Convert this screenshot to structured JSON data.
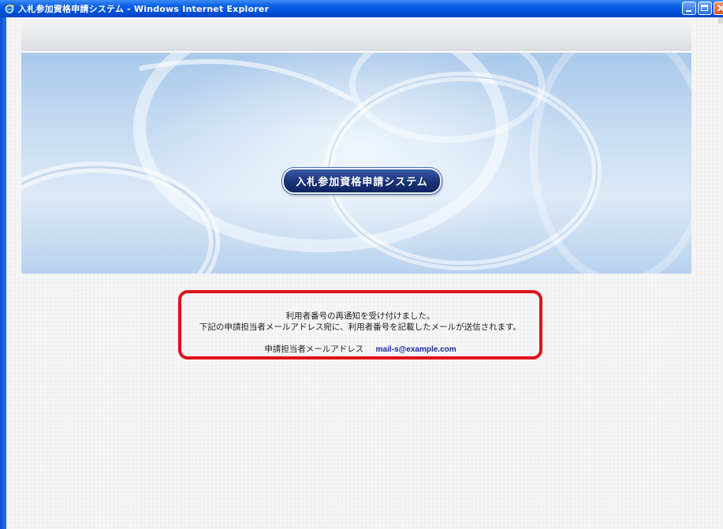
{
  "window": {
    "title": "入札参加資格申請システム - Windows Internet Explorer",
    "brand_color": "#0a5fe6"
  },
  "banner": {
    "logo_text": "入札参加資格申請システム"
  },
  "message": {
    "line1": "利用者番号の再通知を受け付けました。",
    "line2": "下記の申請担当者メールアドレス宛に、利用者番号を記載したメールが送信されます。",
    "email_label": "申請担当者メールアドレス",
    "email_value": "mail-s@example.com",
    "highlight_color": "#e0101a"
  }
}
